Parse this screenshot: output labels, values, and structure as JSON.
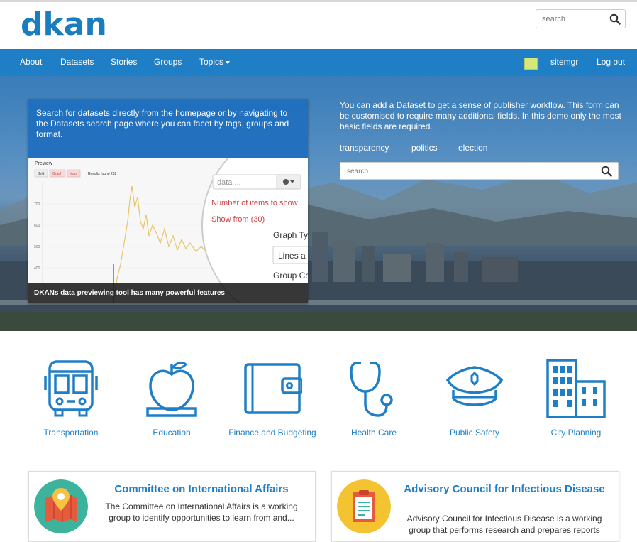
{
  "brand": {
    "logo_text": "dkan",
    "color": "#1a7dbf"
  },
  "top_search": {
    "placeholder": "search"
  },
  "nav": {
    "items": [
      "About",
      "Datasets",
      "Stories",
      "Groups"
    ],
    "topics_label": "Topics",
    "user_label": "sitemgr",
    "logout_label": "Log out"
  },
  "hero": {
    "preview_text": "Search for datasets directly from the homepage or by navigating to the Datasets search page where you can facet by tags, groups and format.",
    "preview_caption": "DKANs data previewing tool has many powerful features",
    "preview_image": {
      "title": "Preview",
      "tabs": [
        "Grid",
        "Graph",
        "Map"
      ],
      "results": "Results found 262",
      "search_placeholder": "data ...",
      "menu_items": [
        "Number of items to show",
        "Show from (30)"
      ],
      "side_labels": [
        "Graph Ty",
        "Lines a",
        "Group Co"
      ],
      "y_ticks": [
        "700",
        "600",
        "500",
        "400",
        "300"
      ]
    },
    "right_text": "You can add a Dataset to get a sense of publisher workflow. This form can be customised to require many additional fields. In this demo only the most basic fields are required.",
    "tags": [
      "transparency",
      "politics",
      "election"
    ],
    "search_placeholder": "search"
  },
  "topics": [
    {
      "label": "Transportation",
      "icon": "bus-icon"
    },
    {
      "label": "Education",
      "icon": "apple-icon"
    },
    {
      "label": "Finance and Budgeting",
      "icon": "wallet-icon"
    },
    {
      "label": "Health Care",
      "icon": "stethoscope-icon"
    },
    {
      "label": "Public Safety",
      "icon": "police-cap-icon"
    },
    {
      "label": "City Planning",
      "icon": "buildings-icon"
    }
  ],
  "groups": [
    {
      "title": "Committee on International Affairs",
      "description": "The Committee on International Affairs is a working group to identify opportunities to learn from and...",
      "logo_color": "#3db39e"
    },
    {
      "title": "Advisory Council for Infectious Disease",
      "description": "Advisory Council for Infectious Disease is a working group that performs research and prepares reports",
      "logo_color": "#f3c331"
    }
  ],
  "colors": {
    "accent": "#1e7fc6",
    "nav_bg": "#1e7fc6"
  }
}
